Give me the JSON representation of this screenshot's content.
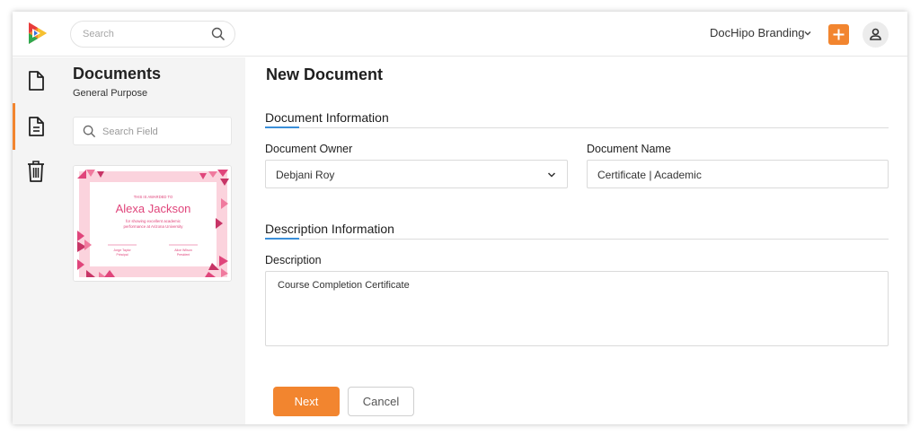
{
  "header": {
    "search_placeholder": "Search",
    "workspace": "DocHipo Branding"
  },
  "panel": {
    "title": "Documents",
    "subtitle": "General Purpose",
    "field_search_placeholder": "Search Field",
    "thumbnail": {
      "kicker": "THIS IS AWARDED TO",
      "name": "Alexa Jackson",
      "line1": "for showing excellent academic",
      "line2": "performance at Arizona University",
      "sig1_name": "Jorge Taylor",
      "sig1_role": "Principal",
      "sig2_name": "Alice Wilson",
      "sig2_role": "President"
    }
  },
  "main": {
    "title": "New Document",
    "section1": "Document Information",
    "owner_label": "Document Owner",
    "owner_value": "Debjani Roy",
    "name_label": "Document Name",
    "name_value": "Certificate | Academic",
    "section2": "Description Information",
    "desc_label": "Description",
    "desc_value": "Course Completion Certificate",
    "next_label": "Next",
    "cancel_label": "Cancel"
  },
  "colors": {
    "accent": "#f2852f",
    "section_underline": "#3a8fd9",
    "certificate_pink": "#e0457b"
  }
}
